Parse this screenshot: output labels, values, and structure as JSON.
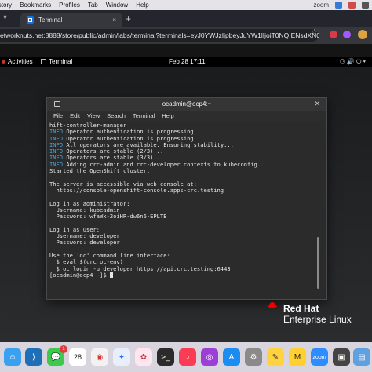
{
  "mac_menubar": {
    "items": [
      "istory",
      "Bookmarks",
      "Profiles",
      "Tab",
      "Window",
      "Help"
    ],
    "zoom_status": "zoom"
  },
  "browser": {
    "tab_title": "Terminal",
    "new_tab": "+",
    "tab_close": "×",
    "url": "etworknuts.net:8888/store/public/admin/labs/terminal?terminals=eyJ0YWJzIjpbeyJuYW1lIjoiT0NQIENsdXN0ZX...",
    "profile_initial": ""
  },
  "gnome": {
    "activities": "Activities",
    "app_name": "Terminal",
    "clock": "Feb 28  17:11"
  },
  "terminal": {
    "title": "ocadmin@ocp4:~",
    "menu": [
      "File",
      "Edit",
      "View",
      "Search",
      "Terminal",
      "Help"
    ],
    "lines": [
      {
        "prefix": "",
        "text": "hift-controller-manager"
      },
      {
        "prefix": "INFO",
        "text": " Operator authentication is progressing"
      },
      {
        "prefix": "INFO",
        "text": " Operator authentication is progressing"
      },
      {
        "prefix": "INFO",
        "text": " All operators are available. Ensuring stability..."
      },
      {
        "prefix": "INFO",
        "text": " Operators are stable (2/3)..."
      },
      {
        "prefix": "INFO",
        "text": " Operators are stable (3/3)..."
      },
      {
        "prefix": "INFO",
        "text": " Adding crc-admin and crc-developer contexts to kubeconfig..."
      },
      {
        "prefix": "",
        "text": "Started the OpenShift cluster."
      },
      {
        "prefix": "",
        "text": ""
      },
      {
        "prefix": "",
        "text": "The server is accessible via web console at:"
      },
      {
        "prefix": "",
        "text": "  https://console-openshift-console.apps-crc.testing"
      },
      {
        "prefix": "",
        "text": ""
      },
      {
        "prefix": "",
        "text": "Log in as administrator:"
      },
      {
        "prefix": "",
        "text": "  Username: kubeadmin"
      },
      {
        "prefix": "",
        "text": "  Password: wfaWx-2oiHR-dw6n6-EPLTB"
      },
      {
        "prefix": "",
        "text": ""
      },
      {
        "prefix": "",
        "text": "Log in as user:"
      },
      {
        "prefix": "",
        "text": "  Username: developer"
      },
      {
        "prefix": "",
        "text": "  Password: developer"
      },
      {
        "prefix": "",
        "text": ""
      },
      {
        "prefix": "",
        "text": "Use the 'oc' command line interface:"
      },
      {
        "prefix": "",
        "text": "  $ eval $(crc oc-env)"
      },
      {
        "prefix": "",
        "text": "  $ oc login -u developer https://api.crc.testing:6443"
      },
      {
        "prefix": "",
        "text": "[ocadmin@ocp4 ~]$ "
      }
    ]
  },
  "branding": {
    "line1": "Red Hat",
    "line2": "Enterprise Linux"
  },
  "dock": {
    "calendar_day": "28",
    "badge_count": "1"
  },
  "colors": {
    "info": "#4aa3d8",
    "redhat_red": "#ee0000",
    "browser_accent": "#1b6fd8"
  }
}
